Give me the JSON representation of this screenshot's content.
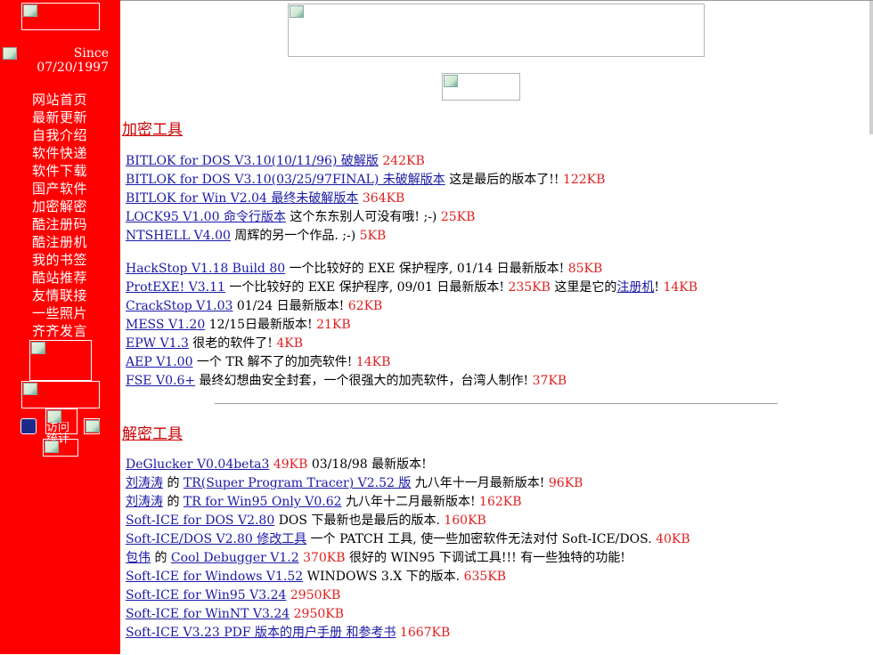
{
  "sidebar": {
    "since_line1": "Since",
    "since_line2": "07/20/1997",
    "nav_items": [
      "网站首页",
      "最新更新",
      "自我介绍",
      "软件快递",
      "软件下载",
      "国产软件",
      "加密解密",
      "酷注册码",
      "酷注册机",
      "我的书签",
      "酷站推荐",
      "友情联接",
      "一些照片",
      "齐齐发言"
    ],
    "counter_alt": "访问统计"
  },
  "sections": [
    {
      "title": "加密工具",
      "groups": [
        [
          [
            {
              "t": "link",
              "v": "BITLOK for DOS V3.10(10/11/96) 破解版"
            },
            {
              "t": "text",
              "v": "  "
            },
            {
              "t": "size",
              "v": "242KB"
            }
          ],
          [
            {
              "t": "link",
              "v": "BITLOK for DOS V3.10(03/25/97FINAL) 未破解版本"
            },
            {
              "t": "text",
              "v": "  这是最后的版本了!! "
            },
            {
              "t": "size",
              "v": "122KB"
            }
          ],
          [
            {
              "t": "link",
              "v": "BITLOK for Win V2.04 最终未破解版本"
            },
            {
              "t": "text",
              "v": " "
            },
            {
              "t": "size",
              "v": "364KB"
            }
          ],
          [
            {
              "t": "link",
              "v": "LOCK95 V1.00 命令行版本"
            },
            {
              "t": "text",
              "v": "   这个东东别人可没有哦! ;-) "
            },
            {
              "t": "size",
              "v": "25KB"
            }
          ],
          [
            {
              "t": "link",
              "v": "NTSHELL V4.00"
            },
            {
              "t": "text",
              "v": "   周辉的另一个作品. ;-) "
            },
            {
              "t": "size",
              "v": "5KB"
            }
          ]
        ],
        [
          [
            {
              "t": "link",
              "v": "HackStop V1.18 Build 80"
            },
            {
              "t": "text",
              "v": "  一个比较好的 EXE 保护程序, 01/14 日最新版本! "
            },
            {
              "t": "size",
              "v": "85KB"
            }
          ],
          [
            {
              "t": "link",
              "v": "ProtEXE! V3.11"
            },
            {
              "t": "text",
              "v": "  一个比较好的 EXE 保护程序, 09/01 日最新版本! "
            },
            {
              "t": "size",
              "v": "235KB"
            },
            {
              "t": "text",
              "v": "  这里是它的"
            },
            {
              "t": "link",
              "v": "注册机"
            },
            {
              "t": "text",
              "v": "! "
            },
            {
              "t": "size",
              "v": "14KB"
            }
          ],
          [
            {
              "t": "link",
              "v": "CrackStop V1.03"
            },
            {
              "t": "text",
              "v": " 01/24 日最新版本! "
            },
            {
              "t": "size",
              "v": "62KB"
            }
          ],
          [
            {
              "t": "link",
              "v": "MESS V1.20"
            },
            {
              "t": "text",
              "v": " 12/15日最新版本! "
            },
            {
              "t": "size",
              "v": "21KB"
            }
          ],
          [
            {
              "t": "link",
              "v": "EPW V1.3"
            },
            {
              "t": "text",
              "v": " 很老的软件了! "
            },
            {
              "t": "size",
              "v": "4KB"
            }
          ],
          [
            {
              "t": "link",
              "v": "AEP V1.00"
            },
            {
              "t": "text",
              "v": " 一个 TR 解不了的加壳软件!  "
            },
            {
              "t": "size",
              "v": "14KB"
            }
          ],
          [
            {
              "t": "link",
              "v": "FSE V0.6+"
            },
            {
              "t": "text",
              "v": "  最终幻想曲安全封套，一个很强大的加壳软件，台湾人制作!  "
            },
            {
              "t": "size",
              "v": "37KB"
            }
          ]
        ]
      ]
    },
    {
      "title": "解密工具",
      "groups": [
        [
          [
            {
              "t": "link",
              "v": "DeGlucker V0.04beta3"
            },
            {
              "t": "text",
              "v": " "
            },
            {
              "t": "size",
              "v": "49KB"
            },
            {
              "t": "text",
              "v": " 03/18/98 最新版本!"
            }
          ],
          [
            {
              "t": "link",
              "v": "刘涛涛"
            },
            {
              "t": "text",
              "v": " 的 "
            },
            {
              "t": "link",
              "v": "TR(Super Program Tracer) V2.52 版"
            },
            {
              "t": "text",
              "v": "  九八年十一月最新版本! "
            },
            {
              "t": "size",
              "v": "96KB"
            }
          ],
          [
            {
              "t": "link",
              "v": "刘涛涛"
            },
            {
              "t": "text",
              "v": " 的 "
            },
            {
              "t": "link",
              "v": "TR for Win95 Only V0.62"
            },
            {
              "t": "text",
              "v": "  九八年十二月最新版本! "
            },
            {
              "t": "size",
              "v": "162KB"
            }
          ],
          [
            {
              "t": "link",
              "v": "Soft-ICE for DOS V2.80"
            },
            {
              "t": "text",
              "v": "  DOS 下最新也是最后的版本. "
            },
            {
              "t": "size",
              "v": "160KB"
            }
          ],
          [
            {
              "t": "link",
              "v": "Soft-ICE/DOS V2.80 修改工具"
            },
            {
              "t": "text",
              "v": "  一个 PATCH 工具, 使一些加密软件无法对付 Soft-ICE/DOS. "
            },
            {
              "t": "size",
              "v": "40KB"
            }
          ],
          [
            {
              "t": "link",
              "v": "包伟"
            },
            {
              "t": "text",
              "v": " 的 "
            },
            {
              "t": "link",
              "v": "Cool Debugger V1.2"
            },
            {
              "t": "text",
              "v": " "
            },
            {
              "t": "size",
              "v": "370KB"
            },
            {
              "t": "text",
              "v": " 很好的 WIN95 下调试工具!!! 有一些独特的功能!"
            }
          ],
          [
            {
              "t": "link",
              "v": "Soft-ICE for Windows V1.52"
            },
            {
              "t": "text",
              "v": "  WINDOWS 3.X 下的版本. "
            },
            {
              "t": "size",
              "v": "635KB"
            }
          ],
          [
            {
              "t": "link",
              "v": "Soft-ICE for Win95 V3.24"
            },
            {
              "t": "text",
              "v": " "
            },
            {
              "t": "size",
              "v": "2950KB"
            }
          ],
          [
            {
              "t": "link",
              "v": "Soft-ICE for WinNT V3.24"
            },
            {
              "t": "text",
              "v": " "
            },
            {
              "t": "size",
              "v": "2950KB"
            }
          ],
          [
            {
              "t": "link",
              "v": "Soft-ICE V3.23 PDF 版本的用户手册 和参考书"
            },
            {
              "t": "text",
              "v": " "
            },
            {
              "t": "size",
              "v": "1667KB"
            }
          ]
        ]
      ]
    }
  ],
  "colors": {
    "sidebar": "#ff0000",
    "link": "#1a1aa6",
    "size": "#e02020",
    "heading": "#cc0000"
  }
}
